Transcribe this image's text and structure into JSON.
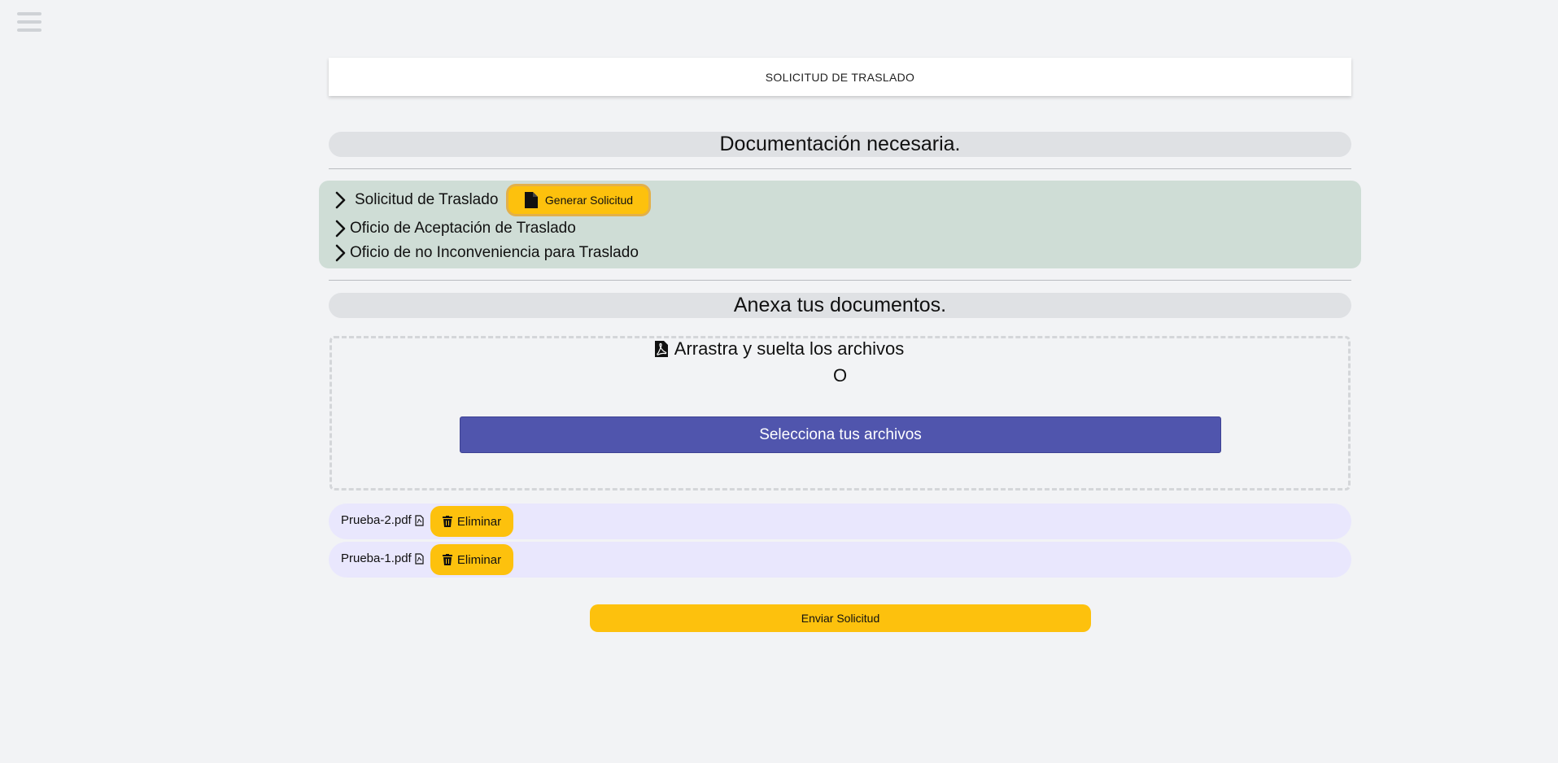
{
  "menu": {
    "icon": "hamburger-menu-icon"
  },
  "header": {
    "title": "SOLICITUD DE TRASLADO"
  },
  "documentation": {
    "title": "Documentación necesaria.",
    "items": [
      {
        "label": "Solicitud de Traslado",
        "icon": "chevron-right-icon"
      },
      {
        "label": "Oficio de Aceptación de Traslado",
        "icon": "chevron-right-icon"
      },
      {
        "label": "Oficio de no Inconveniencia para Traslado",
        "icon": "chevron-right-icon"
      }
    ],
    "generate_button": {
      "label": "Generar Solicitud",
      "icon": "file-icon"
    }
  },
  "attachments": {
    "title": "Anexa tus documentos.",
    "drop_text": "Arrastra y suelta los archivos",
    "drop_icon": "pdf-file-icon",
    "or_text": "O",
    "select_button": "Selecciona tus archivos",
    "files": [
      {
        "name": "Prueba-2.pdf",
        "delete_label": "Eliminar"
      },
      {
        "name": "Prueba-1.pdf",
        "delete_label": "Eliminar"
      }
    ]
  },
  "submit": {
    "label": "Enviar Solicitud"
  },
  "colors": {
    "accent_yellow": "#fdc10d",
    "primary_button": "#5055ad",
    "docs_background": "#cfddd6",
    "file_row_background": "#e9e7fd",
    "page_background": "#f2f3f5"
  }
}
